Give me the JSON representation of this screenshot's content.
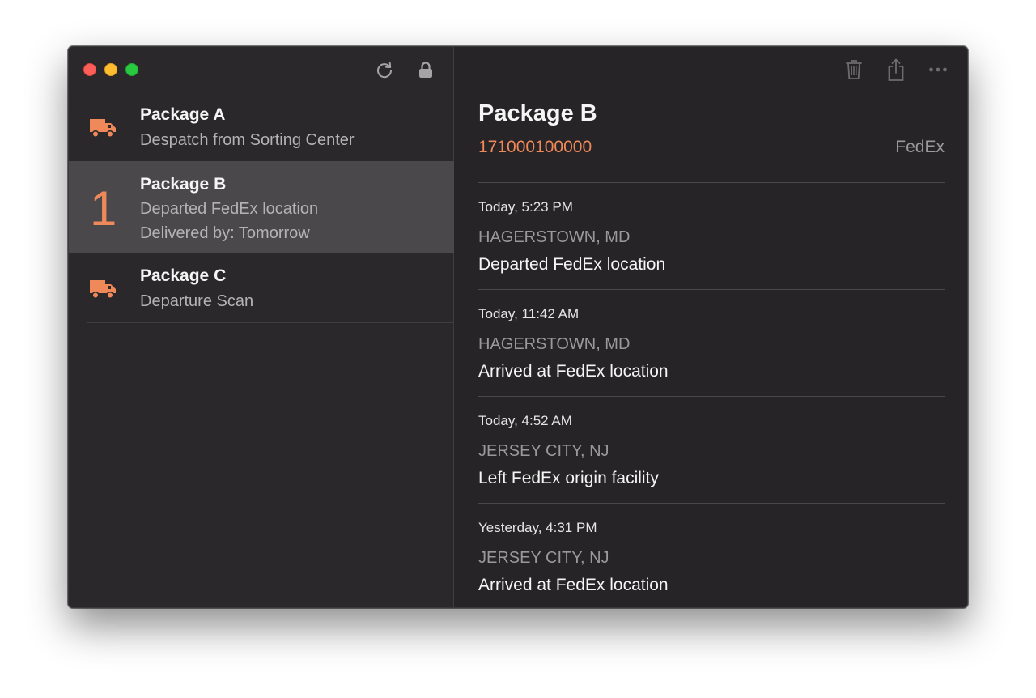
{
  "colors": {
    "accent": "#f0895a",
    "background": "#262426",
    "selected": "#4a484a"
  },
  "sidebar": {
    "toolbar": {
      "refresh_icon": "refresh-icon",
      "lock_icon": "lock-icon"
    },
    "packages": [
      {
        "name": "Package A",
        "status": "Despatch from Sorting Center",
        "icon": "truck-icon"
      },
      {
        "name": "Package B",
        "status": "Departed FedEx location",
        "delivery": "Delivered by: Tomorrow",
        "days": "1"
      },
      {
        "name": "Package C",
        "status": "Departure Scan",
        "icon": "truck-icon"
      }
    ]
  },
  "detail": {
    "toolbar": {
      "trash_icon": "trash-icon",
      "share_icon": "share-icon",
      "more_icon": "more-icon"
    },
    "title": "Package B",
    "tracking_number": "171000100000",
    "carrier": "FedEx",
    "events": [
      {
        "time": "Today, 5:23 PM",
        "location": "HAGERSTOWN, MD",
        "status": "Departed FedEx location"
      },
      {
        "time": "Today, 11:42 AM",
        "location": "HAGERSTOWN, MD",
        "status": "Arrived at FedEx location"
      },
      {
        "time": "Today, 4:52 AM",
        "location": "JERSEY CITY, NJ",
        "status": "Left FedEx origin facility"
      },
      {
        "time": "Yesterday, 4:31 PM",
        "location": "JERSEY CITY, NJ",
        "status": "Arrived at FedEx location"
      }
    ]
  }
}
